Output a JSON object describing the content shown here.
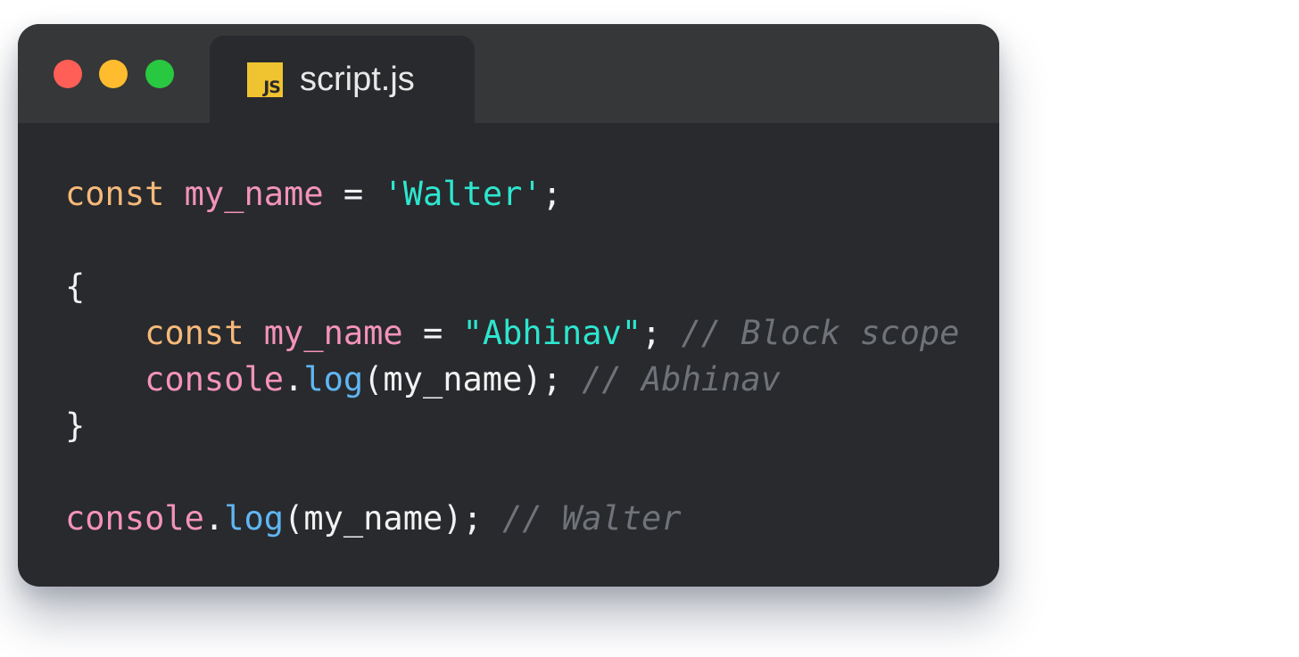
{
  "window": {
    "colors": {
      "close": "#ff5f57",
      "minimize": "#febc2e",
      "zoom": "#28c840"
    }
  },
  "tab": {
    "icon_label": "JS",
    "label": "script.js"
  },
  "code": {
    "token_colors": {
      "keyword": "#f6b97a",
      "identifier": "#f393b9",
      "string": "#2ee6cf",
      "function": "#60b6f2",
      "punctuation": "#f2f2f2",
      "comment": "#6f7379"
    },
    "lines": [
      [
        {
          "t": "const",
          "k": "kw"
        },
        {
          "t": " ",
          "k": "p"
        },
        {
          "t": "my_name",
          "k": "id"
        },
        {
          "t": " = ",
          "k": "p"
        },
        {
          "t": "'Walter'",
          "k": "str"
        },
        {
          "t": ";",
          "k": "p"
        }
      ],
      [],
      [
        {
          "t": "{",
          "k": "p"
        }
      ],
      [
        {
          "t": "    ",
          "k": "p"
        },
        {
          "t": "const",
          "k": "kw"
        },
        {
          "t": " ",
          "k": "p"
        },
        {
          "t": "my_name",
          "k": "id"
        },
        {
          "t": " = ",
          "k": "p"
        },
        {
          "t": "\"Abhinav\"",
          "k": "str"
        },
        {
          "t": "; ",
          "k": "p"
        },
        {
          "t": "// Block scope",
          "k": "cm"
        }
      ],
      [
        {
          "t": "    ",
          "k": "p"
        },
        {
          "t": "console",
          "k": "id"
        },
        {
          "t": ".",
          "k": "p"
        },
        {
          "t": "log",
          "k": "fn"
        },
        {
          "t": "(my_name); ",
          "k": "p"
        },
        {
          "t": "// Abhinav",
          "k": "cm"
        }
      ],
      [
        {
          "t": "}",
          "k": "p"
        }
      ],
      [],
      [
        {
          "t": "console",
          "k": "id"
        },
        {
          "t": ".",
          "k": "p"
        },
        {
          "t": "log",
          "k": "fn"
        },
        {
          "t": "(my_name); ",
          "k": "p"
        },
        {
          "t": "// Walter",
          "k": "cm"
        }
      ]
    ]
  }
}
